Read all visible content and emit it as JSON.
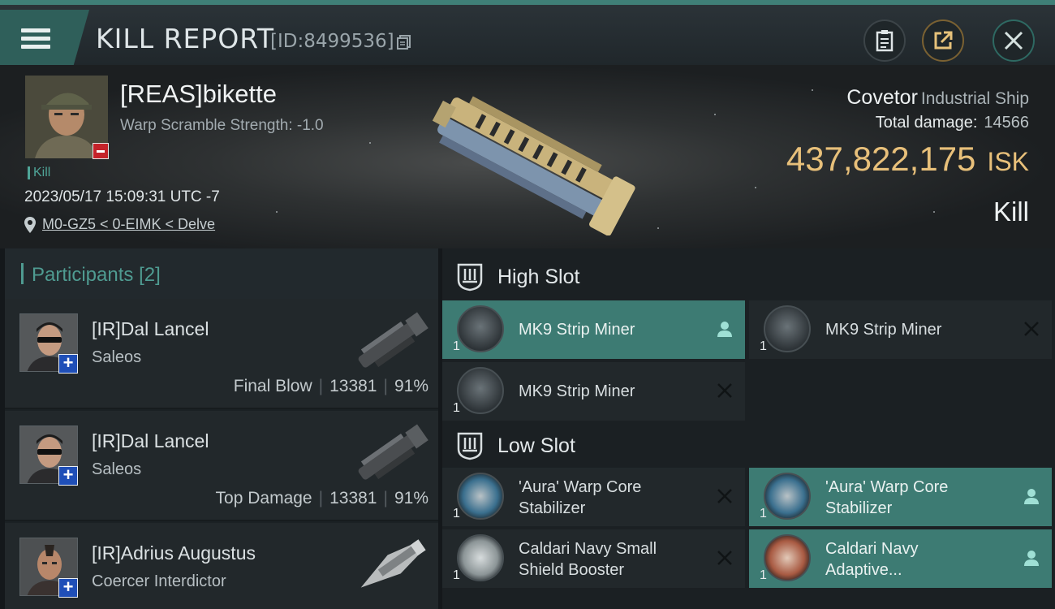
{
  "header": {
    "title": "KILL REPORT",
    "report_id": "[ID:8499536]",
    "icons": {
      "menu": "hamburger-icon",
      "copy": "copy-icon",
      "report": "clipboard-icon",
      "share": "share-icon",
      "close": "close-icon"
    }
  },
  "victim": {
    "name": "[REAS]bikette",
    "warp_scramble": "Warp Scramble Strength: -1.0",
    "tag": "Kill",
    "datetime": "2023/05/17 15:09:31 UTC -7",
    "location": "M0-GZ5 < 0-EIMK < Delve",
    "ship_name": "Covetor",
    "ship_class": "Industrial Ship",
    "total_damage_label": "Total damage:",
    "total_damage": "14566",
    "isk_value": "437,822,175",
    "isk_unit": "ISK",
    "result": "Kill"
  },
  "participants": {
    "title": "Participants",
    "count": "[2]",
    "rows": [
      {
        "name": "[IR]Dal Lancel",
        "ship": "Saleos",
        "stat_label": "Final Blow",
        "damage": "13381",
        "percent": "91%"
      },
      {
        "name": "[IR]Dal Lancel",
        "ship": "Saleos",
        "stat_label": "Top Damage",
        "damage": "13381",
        "percent": "91%"
      },
      {
        "name": "[IR]Adrius Augustus",
        "ship": "Coercer Interdictor",
        "stat_label": "",
        "damage": "",
        "percent": ""
      }
    ]
  },
  "fittings": {
    "high_slot_title": "High Slot",
    "low_slot_title": "Low Slot",
    "high": [
      {
        "name": "MK9 Strip Miner",
        "qty": "1",
        "status": "dropped"
      },
      {
        "name": "MK9 Strip Miner",
        "qty": "1",
        "status": "destroyed"
      },
      {
        "name": "MK9 Strip Miner",
        "qty": "1",
        "status": "destroyed"
      }
    ],
    "low": [
      {
        "name_line1": "'Aura' Warp Core",
        "name_line2": "Stabilizer",
        "qty": "1",
        "status": "destroyed"
      },
      {
        "name_line1": "'Aura' Warp Core",
        "name_line2": "Stabilizer",
        "qty": "1",
        "status": "dropped"
      },
      {
        "name_line1": "Caldari Navy Small",
        "name_line2": "Shield Booster",
        "qty": "1",
        "status": "destroyed"
      },
      {
        "name_line1": "Caldari Navy",
        "name_line2": "Adaptive...",
        "qty": "1",
        "status": "dropped"
      }
    ]
  },
  "colors": {
    "accent_teal": "#3d7b73",
    "isk_gold": "#e8c07a",
    "kill_badge_red": "#c4232a",
    "plus_badge_blue": "#1f4fb8"
  }
}
